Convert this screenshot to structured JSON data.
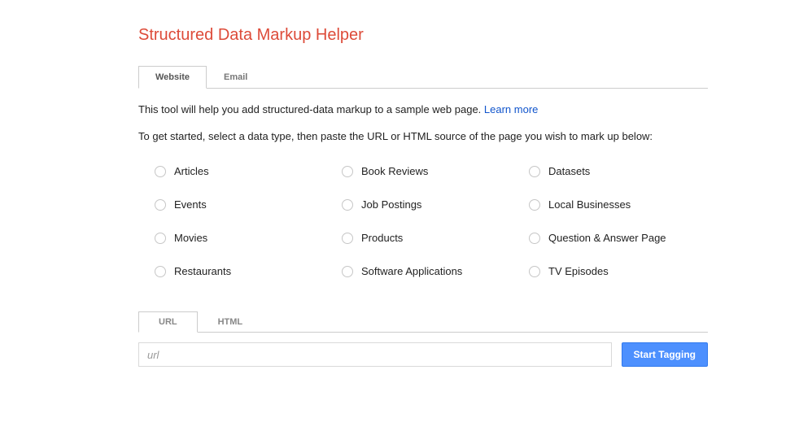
{
  "title": "Structured Data Markup Helper",
  "topTabs": {
    "website": "Website",
    "email": "Email"
  },
  "intro": {
    "text": "This tool will help you add structured-data markup to a sample web page. ",
    "link": "Learn more"
  },
  "instructions": "To get started, select a data type, then paste the URL or HTML source of the page you wish to mark up below:",
  "dataTypes": [
    "Articles",
    "Book Reviews",
    "Datasets",
    "Events",
    "Job Postings",
    "Local Businesses",
    "Movies",
    "Products",
    "Question & Answer Page",
    "Restaurants",
    "Software Applications",
    "TV Episodes"
  ],
  "inputTabs": {
    "url": "URL",
    "html": "HTML"
  },
  "urlInput": {
    "placeholder": "url",
    "value": ""
  },
  "startButton": "Start Tagging"
}
